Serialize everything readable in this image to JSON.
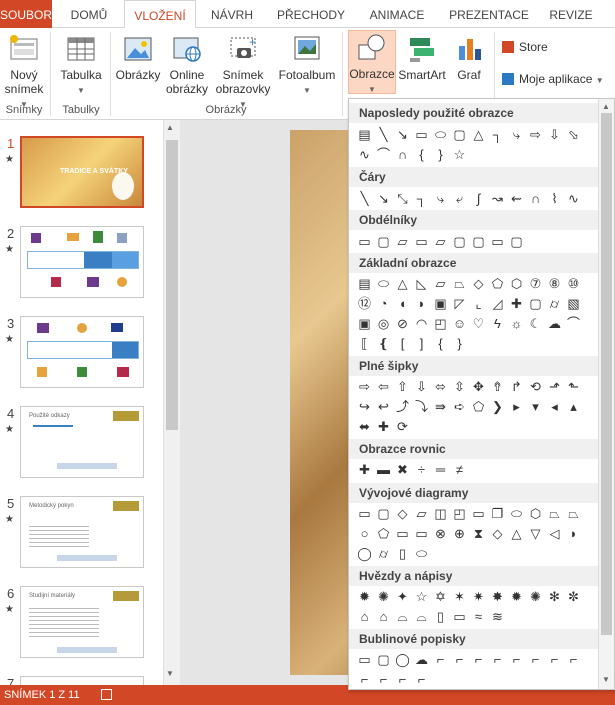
{
  "tabs": [
    "SOUBOR",
    "DOMŮ",
    "VLOŽENÍ",
    "NÁVRH",
    "PŘECHODY",
    "ANIMACE",
    "PREZENTACE",
    "REVIZE"
  ],
  "ribbon": {
    "new_slide": "Nový snímek",
    "table": "Tabulka",
    "pictures": "Obrázky",
    "online_pictures": "Online obrázky",
    "screenshot": "Snímek obrazovky",
    "photo_album": "Fotoalbum",
    "shapes": "Obrazce",
    "smartart": "SmartArt",
    "chart": "Graf",
    "store": "Store",
    "my_apps": "Moje aplikace",
    "groups": {
      "slides": "Snímky",
      "tables": "Tabulky",
      "images": "Obrázky"
    }
  },
  "slides": [
    {
      "num": "1",
      "title": "TRADICE A SVÁTKY"
    },
    {
      "num": "2",
      "title": ""
    },
    {
      "num": "3",
      "title": ""
    },
    {
      "num": "4",
      "title": "Použité odkazy"
    },
    {
      "num": "5",
      "title": "Metodický pokyn"
    },
    {
      "num": "6",
      "title": "Studijní materiály"
    },
    {
      "num": "7",
      "title": ""
    }
  ],
  "status": {
    "slide_counter": "SNÍMEK 1 Z 11"
  },
  "dropdown": {
    "sections": [
      "Naposledy použité obrazce",
      "Čáry",
      "Obdélníky",
      "Základní obrazce",
      "Plné šipky",
      "Obrazce rovnic",
      "Vývojové diagramy",
      "Hvězdy a nápisy",
      "Bublinové popisky"
    ]
  },
  "colors": {
    "accent": "#d24726"
  }
}
